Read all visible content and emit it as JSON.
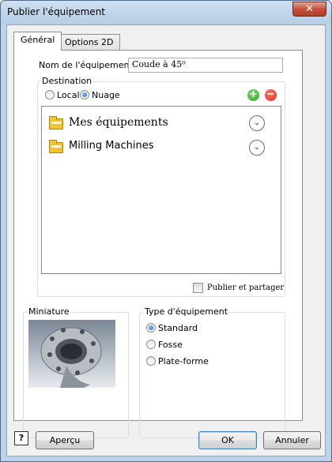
{
  "window": {
    "title": "Publier l'équipement",
    "close_glyph": "✕"
  },
  "tabs": [
    {
      "label": "Général",
      "active": true
    },
    {
      "label": "Options 2D",
      "active": false
    }
  ],
  "name_field": {
    "label": "Nom de l'équipement:",
    "value": "Coude à 45⁰"
  },
  "destination": {
    "title": "Destination",
    "options": [
      {
        "label": "Local",
        "selected": false
      },
      {
        "label": "Nuage",
        "selected": true
      }
    ],
    "add_icon": "plus-circle-icon",
    "remove_icon": "minus-circle-icon",
    "items": [
      {
        "label": "Mes équipements",
        "icon": "folder-icon"
      },
      {
        "label": "Milling Machines",
        "icon": "folder-icon"
      }
    ],
    "publish_share_label": "Publier et partager"
  },
  "thumbnail": {
    "title": "Miniature"
  },
  "equipment_type": {
    "title": "Type d'équipement",
    "options": [
      {
        "label": "Standard",
        "selected": true
      },
      {
        "label": "Fosse",
        "selected": false
      },
      {
        "label": "Plate-forme",
        "selected": false
      }
    ]
  },
  "buttons": {
    "help": "?",
    "preview": "Aperçu",
    "ok": "OK",
    "cancel": "Annuler"
  },
  "colors": {
    "add": "#2aa52a",
    "remove": "#d9261c",
    "accent": "#3c7fb1"
  }
}
